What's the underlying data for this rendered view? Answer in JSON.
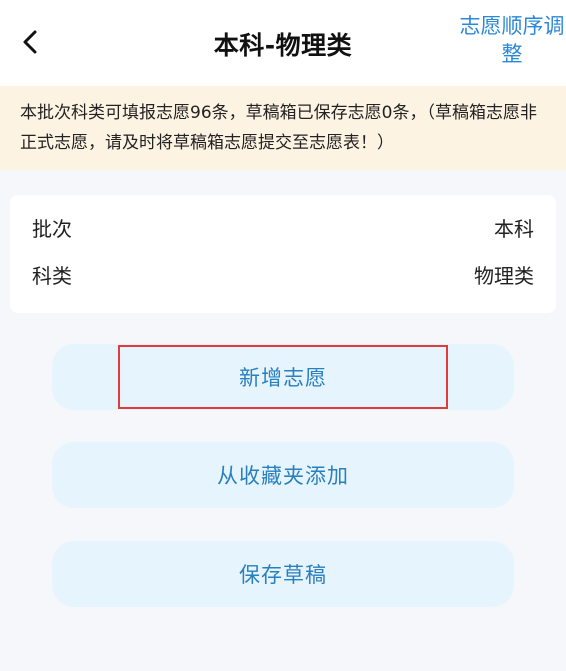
{
  "header": {
    "title": "本科-物理类",
    "reorder_label": "志愿顺序调整",
    "back_icon": "chevron-left-icon"
  },
  "notice": {
    "text": "本批次科类可填报志愿96条，草稿箱已保存志愿0条，（草稿箱志愿非正式志愿，请及时将草稿箱志愿提交至志愿表！）"
  },
  "info": {
    "batch_label": "批次",
    "batch_value": "本科",
    "category_label": "科类",
    "category_value": "物理类"
  },
  "actions": {
    "add_label": "新增志愿",
    "favorites_label": "从收藏夹添加",
    "save_label": "保存草稿"
  },
  "colors": {
    "accent": "#2b88d8",
    "button_bg": "#e6f5fd",
    "notice_bg": "#fdf3e3",
    "highlight": "#e23b3b"
  }
}
